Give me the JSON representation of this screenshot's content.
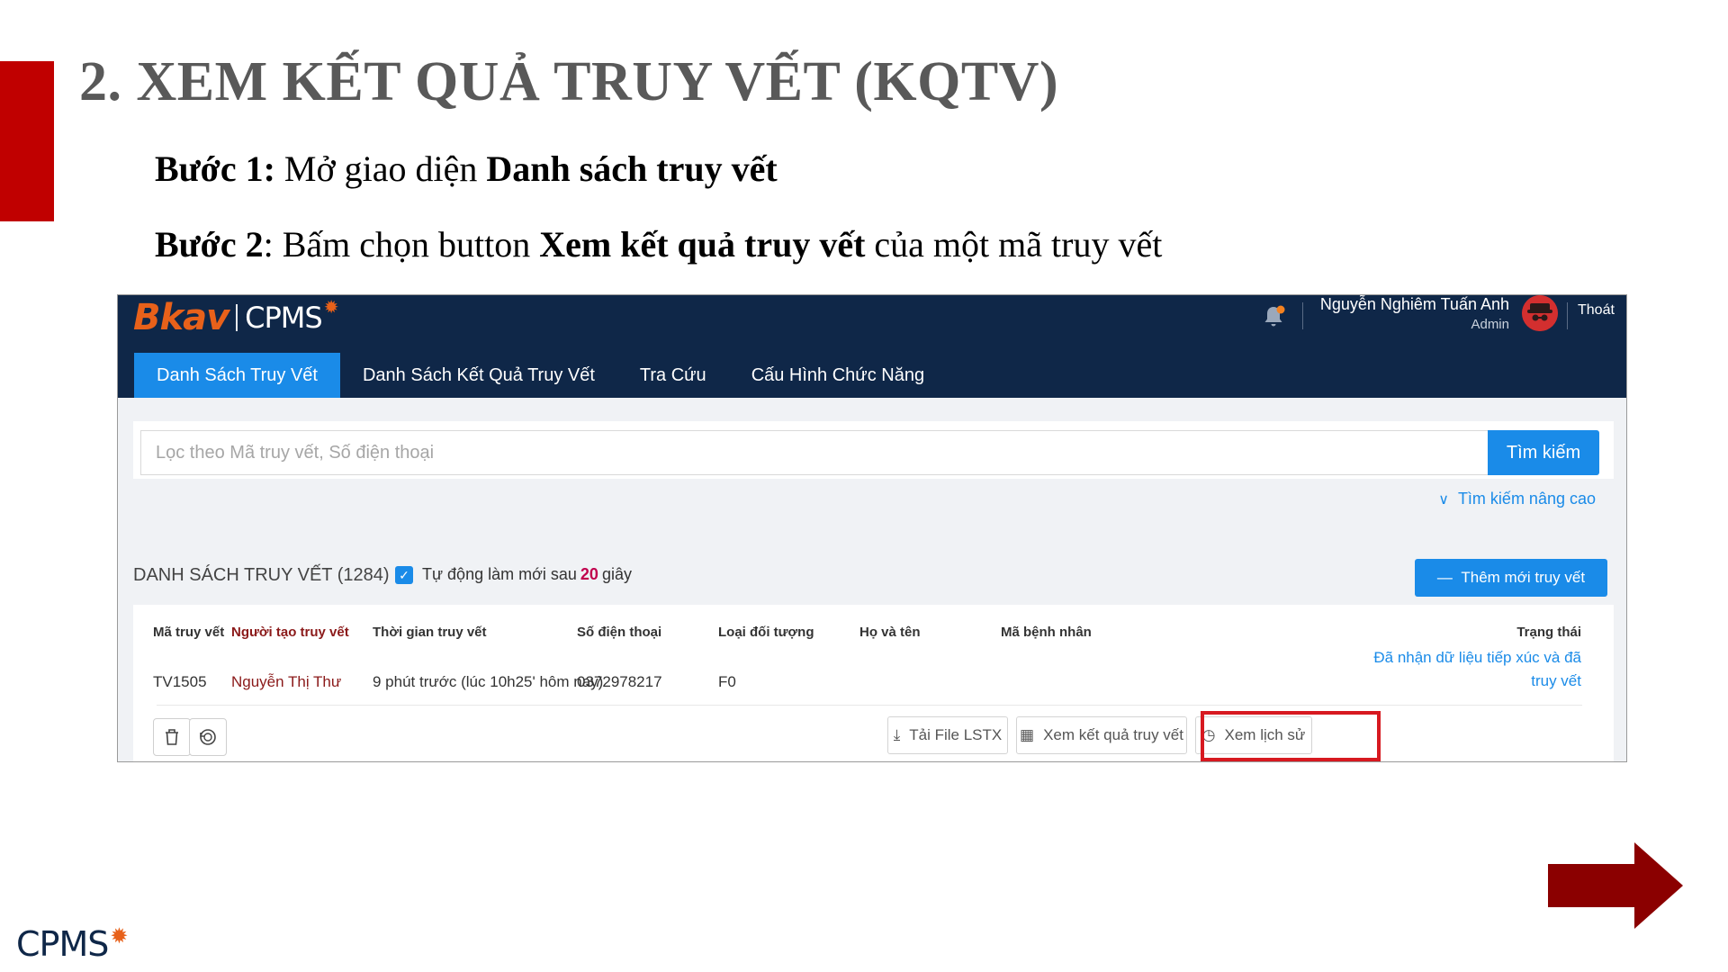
{
  "slide": {
    "title": "2. XEM KẾT QUẢ TRUY VẾT (KQTV)",
    "step1": {
      "label": "Bước 1:",
      "text": " Mở giao diện ",
      "bold": "Danh sách truy vết"
    },
    "step2": {
      "label": "Bước 2",
      "text_a": ": Bấm chọn button ",
      "bold": "Xem kết quả truy vết",
      "text_b": " của một mã truy vết"
    },
    "bottom_logo": "CPMS",
    "accent_color": "#c00000",
    "arrow_color": "#8b0000",
    "arrow_icon": "arrow-right-icon"
  },
  "app": {
    "logo_primary": "Bkav",
    "logo_secondary": "CPMS",
    "user": {
      "name": "Nguyễn Nghiêm Tuấn Anh",
      "role": "Admin"
    },
    "logout_label": "Thoát",
    "nav": [
      {
        "label": "Danh Sách Truy Vết",
        "active": true
      },
      {
        "label": "Danh Sách Kết Quả Truy Vết",
        "active": false
      },
      {
        "label": "Tra Cứu",
        "active": false
      },
      {
        "label": "Cấu Hình Chức Năng",
        "active": false
      }
    ],
    "search": {
      "placeholder": "Lọc theo Mã truy vết, Số điện thoại",
      "button_label": "Tìm kiếm"
    },
    "advanced_search_label": "Tìm kiếm nâng cao",
    "list": {
      "title": "DANH SÁCH TRUY VẾT (1284)",
      "auto_refresh_prefix": "Tự động làm mới sau",
      "auto_refresh_seconds": "20",
      "auto_refresh_suffix": "giây",
      "add_button_label": "Thêm mới truy vết"
    },
    "table": {
      "columns": [
        "Mã truy vết",
        "Người tạo truy vết",
        "Thời gian truy vết",
        "Số điện thoại",
        "Loại đối tượng",
        "Họ và tên",
        "Mã bệnh nhân",
        "Trạng thái"
      ],
      "rows": [
        {
          "ma_truy_vet": "TV1505",
          "nguoi_tao": "Nguyễn Thị Thư",
          "thoi_gian": "9 phút trước (lúc 10h25' hôm nay)",
          "so_dien_thoai": "0372978217",
          "loai_doi_tuong": "F0",
          "ho_va_ten": "",
          "ma_benh_nhan": "",
          "trang_thai": "Đã nhận dữ liệu tiếp xúc và đã truy vết"
        }
      ]
    },
    "actions": {
      "download_label": "Tải File LSTX",
      "view_result_label": "Xem kết quả truy vết",
      "history_label": "Xem lịch sử"
    },
    "colors": {
      "header": "#0f2748",
      "primary": "#1a8be8",
      "highlight": "#d71920"
    }
  }
}
